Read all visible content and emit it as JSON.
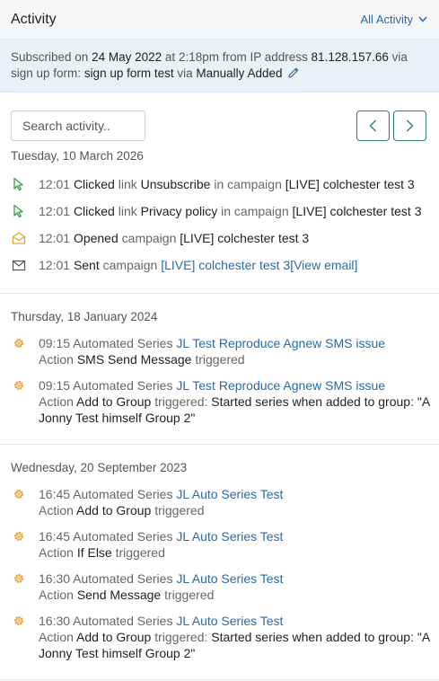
{
  "header": {
    "title": "Activity",
    "filter_label": "All Activity"
  },
  "subscription": {
    "prefix": "Subscribed on",
    "date": "24 May 2022",
    "at": "at",
    "time": "2:18pm",
    "from_ip": "from IP address",
    "ip": "81.128.157.66",
    "via": "via",
    "signup_form": "sign up form:",
    "form_name": "sign up form test",
    "via2": "via",
    "method": "Manually Added"
  },
  "search": {
    "placeholder": "Search activity.."
  },
  "groups": [
    {
      "date": "Tuesday, 10 March 2026",
      "items": [
        {
          "time": "12:01",
          "action": "Clicked",
          "kind": "link",
          "target": "Unsubscribe",
          "in": "in campaign",
          "campaign": "[LIVE] colchester test 3"
        },
        {
          "time": "12:01",
          "action": "Clicked",
          "kind": "link",
          "target": "Privacy policy",
          "in": "in campaign",
          "campaign": "[LIVE] colchester test 3"
        },
        {
          "time": "12:01",
          "action": "Opened",
          "kind": "campaign",
          "campaign": "[LIVE] colchester test 3"
        },
        {
          "time": "12:01",
          "action": "Sent",
          "kind": "campaign",
          "campaign": "[LIVE] colchester test 3",
          "view_email": "[View email]"
        }
      ]
    },
    {
      "date": "Thursday, 18 January 2024",
      "items": [
        {
          "time": "09:15",
          "label": "Automated Series",
          "series": "JL Test Reproduce Agnew SMS issue",
          "action_label": "Action",
          "action": "SMS Send Message",
          "status": "triggered"
        },
        {
          "time": "09:15",
          "label": "Automated Series",
          "series": "JL Test Reproduce Agnew SMS issue",
          "action_label": "Action",
          "action": "Add to Group",
          "status": "triggered:",
          "detail": "Started series when added to group: \"A Jonny Test himself Group 2\""
        }
      ]
    },
    {
      "date": "Wednesday, 20 September 2023",
      "items": [
        {
          "time": "16:45",
          "label": "Automated Series",
          "series": "JL Auto Series Test",
          "action_label": "Action",
          "action": "Add to Group",
          "status": "triggered"
        },
        {
          "time": "16:45",
          "label": "Automated Series",
          "series": "JL Auto Series Test",
          "action_label": "Action",
          "action": "If Else",
          "status": "triggered"
        },
        {
          "time": "16:30",
          "label": "Automated Series",
          "series": "JL Auto Series Test",
          "action_label": "Action",
          "action": "Send Message",
          "status": "triggered"
        },
        {
          "time": "16:30",
          "label": "Automated Series",
          "series": "JL Auto Series Test",
          "action_label": "Action",
          "action": "Add to Group",
          "status": "triggered:",
          "detail": "Started series when added to group: \"A Jonny Test himself Group 2\""
        }
      ]
    }
  ],
  "colors": {
    "link": "#2a6aa6",
    "click_icon": "#3a9b4a",
    "open_icon": "#e8a33d",
    "gear_icon": "#e8a33d",
    "pager_border": "#2e7d6a"
  }
}
